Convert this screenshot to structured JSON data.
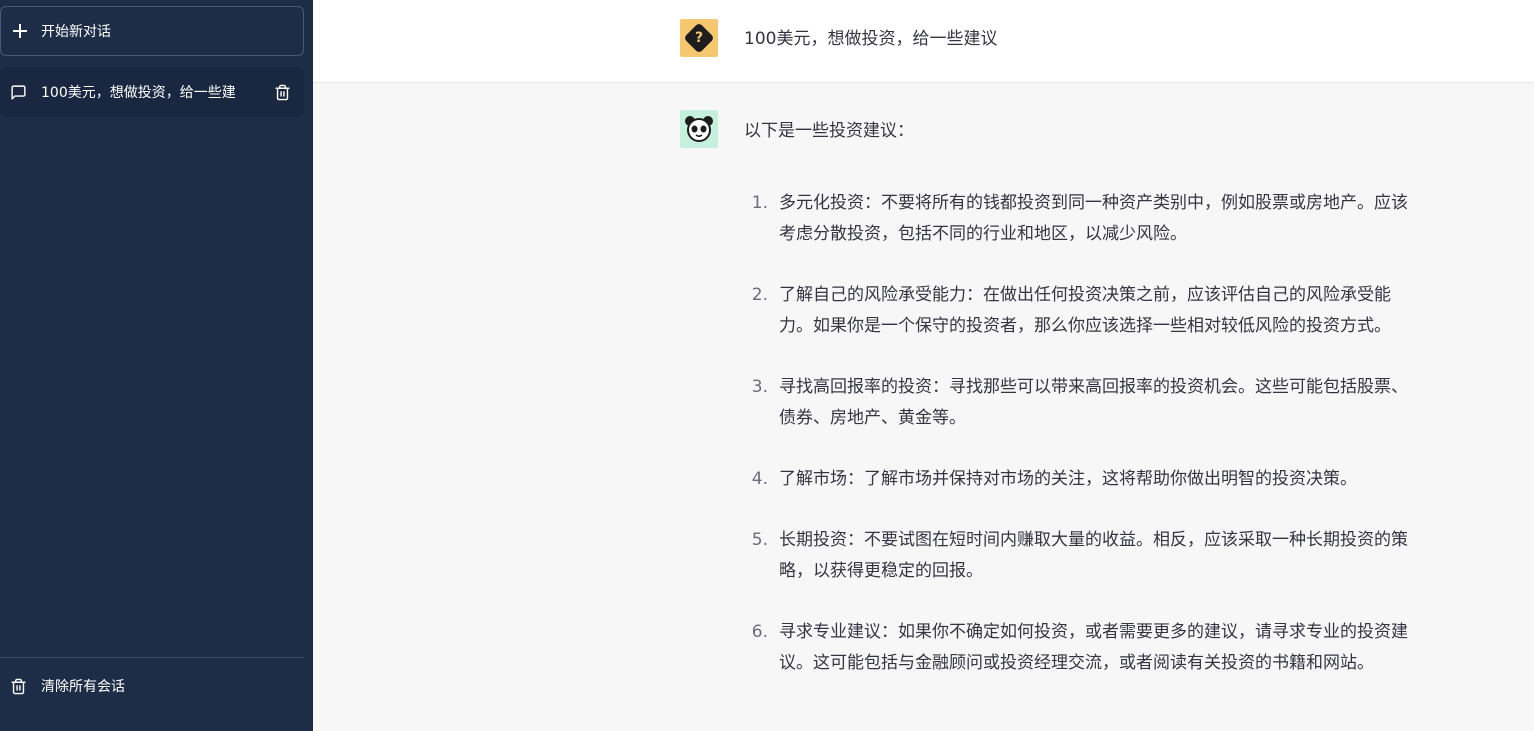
{
  "sidebar": {
    "new_chat_label": "开始新对话",
    "conversations": [
      {
        "title": "100美元，想做投资，给一些建"
      }
    ],
    "clear_all_label": "清除所有会话"
  },
  "chat": {
    "user_message": "100美元，想做投资，给一些建议",
    "assistant_intro": "以下是一些投资建议：",
    "assistant_items": [
      {
        "num": "1.",
        "text": "多元化投资：不要将所有的钱都投资到同一种资产类别中，例如股票或房地产。应该考虑分散投资，包括不同的行业和地区，以减少风险。"
      },
      {
        "num": "2.",
        "text": "了解自己的风险承受能力：在做出任何投资决策之前，应该评估自己的风险承受能力。如果你是一个保守的投资者，那么你应该选择一些相对较低风险的投资方式。"
      },
      {
        "num": "3.",
        "text": "寻找高回报率的投资：寻找那些可以带来高回报率的投资机会。这些可能包括股票、债券、房地产、黄金等。"
      },
      {
        "num": "4.",
        "text": "了解市场：了解市场并保持对市场的关注，这将帮助你做出明智的投资决策。"
      },
      {
        "num": "5.",
        "text": "长期投资：不要试图在短时间内赚取大量的收益。相反，应该采取一种长期投资的策略，以获得更稳定的回报。"
      },
      {
        "num": "6.",
        "text": "寻求专业建议：如果你不确定如何投资，或者需要更多的建议，请寻求专业的投资建议。这可能包括与金融顾问或投资经理交流，或者阅读有关投资的书籍和网站。"
      }
    ]
  },
  "colors": {
    "sidebar_bg": "#1e2d47",
    "user_avatar_bg": "#f5c86f",
    "bot_avatar_bg": "#c6f0de"
  }
}
